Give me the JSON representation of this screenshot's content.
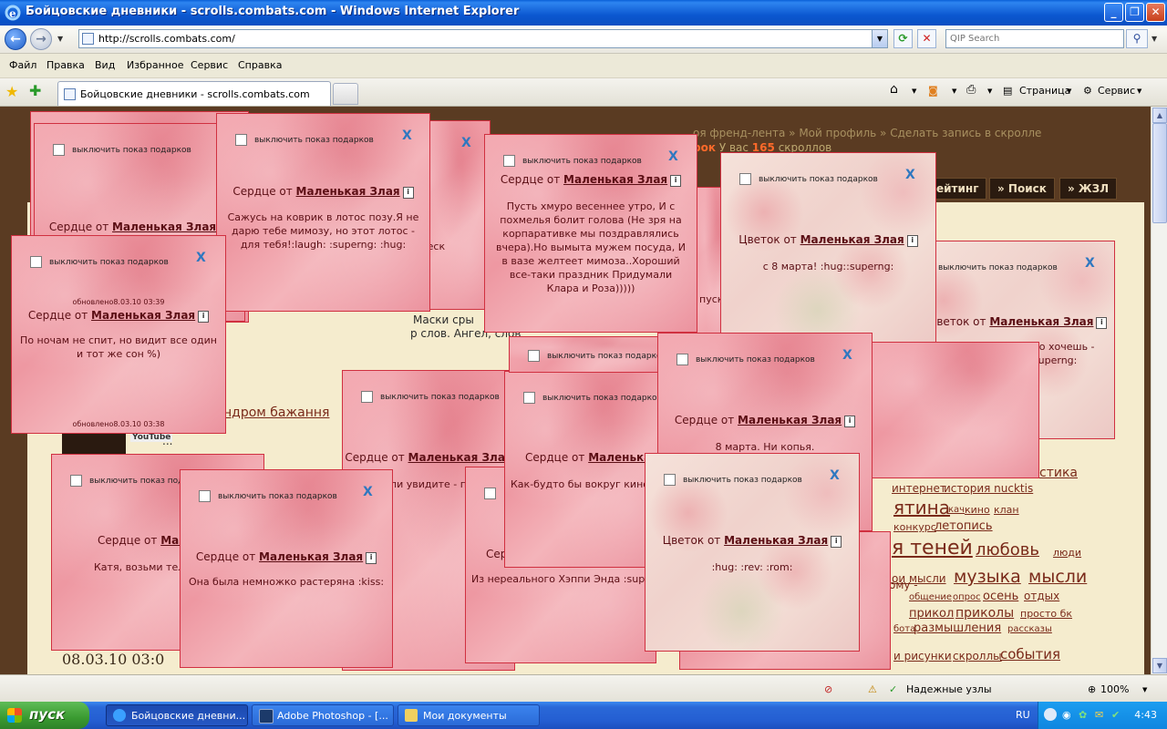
{
  "window": {
    "title": "Бойцовские дневники - scrolls.combats.com - Windows Internet Explorer",
    "tab_title": "Бойцовские дневники - scrolls.combats.com",
    "url": "http://scrolls.combats.com/",
    "search_placeholder": "QIP Search"
  },
  "menu": [
    "Файл",
    "Правка",
    "Вид",
    "Избранное",
    "Сервис",
    "Справка"
  ],
  "commandbar": {
    "page": "Страница",
    "tools": "Сервис"
  },
  "site": {
    "links": "оя френд-лента » Мой профиль » Сделать запись в скролле",
    "scroll_count_prefix": "рок",
    "scroll_count_text": "У вас",
    "scroll_count_num": "165",
    "scroll_count_suffix": "скроллов",
    "nav": [
      "ейтинг",
      "» Поиск",
      "» ЖЗЛ"
    ],
    "ghost_texts": [
      "Маски сры",
      "р слов. Ангел, слов",
      "ндром бажання",
      "...",
      "08.03.10 03:0",
      "ическ",
      "пуск"
    ],
    "youtube": "YouTube",
    "tags": [
      "стика",
      "интернет",
      "история nucktis",
      "ятина",
      "кач",
      "кино",
      "клан",
      "конкурс",
      "летопись",
      "я теней",
      "любовь",
      "люди",
      "ои мысли",
      "музыка",
      "мысли",
      "общение",
      "опрос",
      "осень",
      "отдых",
      "прикол",
      "приколы",
      "просто бк",
      "бота",
      "размышления",
      "рассказы",
      "и рисунки",
      "скроллы",
      "события",
      "ому -"
    ]
  },
  "gifts": {
    "off_label": "выключить показ подарков",
    "close": "X",
    "author": "Маленькая Злая",
    "info": "i",
    "items": [
      {
        "kind": "Сердце от",
        "msg": "",
        "upd": ""
      },
      {
        "kind": "Сердце от",
        "msg": "",
        "upd": ""
      },
      {
        "kind": "Сердце от",
        "msg": "По ночам не спит, но видит все один и тот же сон %)",
        "upd": "обновлено8.03.10 03:39",
        "upd2": "обновлено8.03.10 03:38"
      },
      {
        "kind": "Сердце от",
        "msg": "Сажусь на коврик в лотос позу.Я не дарю тебе мимозу, но этот лотос - для тебя!:laugh: :superng: :hug:",
        "upd": ""
      },
      {
        "kind": "Сердце от",
        "msg": "Пусть хмуро весеннее утро, И с похмелья болит голова (Не зря на корпаративке мы поздравлялись вчера).Но вымыта мужем посуда, И в вазе желтеет мимоза..Хороший все-таки праздник Придумали Клара и Роза)))))",
        "upd": ""
      },
      {
        "kind": "Цветок от",
        "msg": "с 8 марта! :hug::superng:",
        "upd": ""
      },
      {
        "kind": "Цветок от",
        "msg": "дня твой день! все, что хочешь - чтобы было!:hug::superng:",
        "upd": ""
      },
      {
        "kind": "Сердце от",
        "msg": "8 марта. Ни копья.",
        "upd": ""
      },
      {
        "kind": "Цветок от",
        "msg": ":hug: :rev: :rom:",
        "upd": ""
      },
      {
        "kind": "Сердце от",
        "msg": "Она была немножко растеряна :kiss:",
        "upd": ""
      },
      {
        "kind": "Сердце от",
        "msg": "Катя, возьми тел",
        "upd": ""
      },
      {
        "kind": "Сердце от",
        "msg": "ли увидите - п",
        "upd": ""
      },
      {
        "kind": "Сердце от",
        "msg": "Как-будто бы вокруг кино",
        "upd": ""
      },
      {
        "kind": "Сер",
        "msg": "Из нереального Хэппи Энда :sup",
        "upd": ""
      }
    ]
  },
  "status": {
    "secure": "Надежные узлы",
    "zoom": "100%"
  },
  "taskbar": {
    "start": "пуск",
    "items": [
      "Бойцовские дневни...",
      "Adobe Photoshop - [...",
      "Мои документы"
    ],
    "lang": "RU",
    "clock": "4:43"
  }
}
